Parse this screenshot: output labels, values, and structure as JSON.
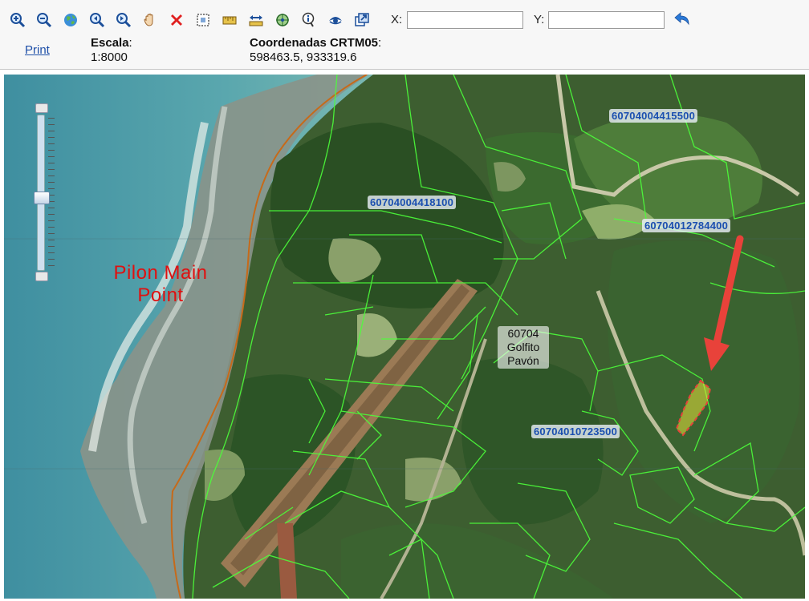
{
  "toolbar": {
    "tools": [
      {
        "name": "zoom-in-icon"
      },
      {
        "name": "zoom-out-icon"
      },
      {
        "name": "full-extent-icon"
      },
      {
        "name": "zoom-previous-icon"
      },
      {
        "name": "zoom-next-icon"
      },
      {
        "name": "pan-hand-icon"
      },
      {
        "name": "clear-icon"
      },
      {
        "name": "select-box-icon"
      },
      {
        "name": "measure-icon"
      },
      {
        "name": "measure-distance-icon"
      },
      {
        "name": "locate-icon"
      },
      {
        "name": "identify-icon"
      },
      {
        "name": "visibility-icon"
      },
      {
        "name": "external-window-icon"
      }
    ],
    "x_label": "X:",
    "y_label": "Y:",
    "x_value": "",
    "y_value": ""
  },
  "print_label": "Print",
  "scale": {
    "label": "Escala",
    "colon": ":",
    "value": "1:8000"
  },
  "coords": {
    "label": "Coordenadas CRTM05",
    "colon": ":",
    "value": "598463.5, 933319.6"
  },
  "map": {
    "place_label": [
      "Pilon Main",
      "Point"
    ],
    "parcels": [
      "60704004415500",
      "60704004418100",
      "60704012784400",
      "60704010723500"
    ],
    "district": [
      "60704",
      "Golfito",
      "Pavón"
    ],
    "colors": {
      "parcel_lines": "#4cff3a",
      "highlight": "#e8e23a",
      "arrow": "#e8423a"
    }
  }
}
